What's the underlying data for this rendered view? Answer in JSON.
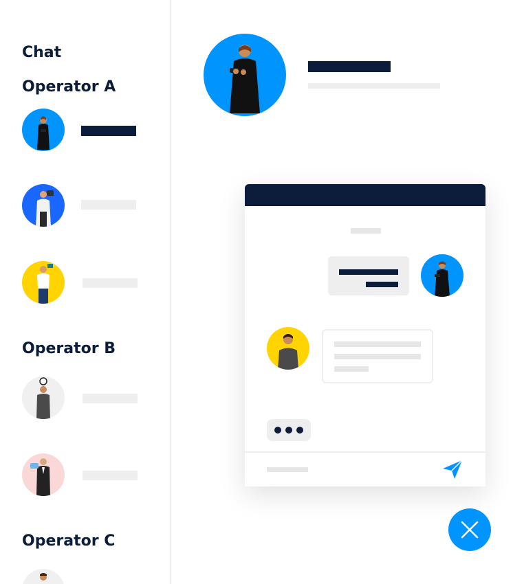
{
  "sidebar": {
    "title": "Chat",
    "groups": [
      {
        "label": "Operator A"
      },
      {
        "label": "Operator B"
      },
      {
        "label": "Operator C"
      }
    ]
  },
  "colors": {
    "navy": "#0b1d3a",
    "blue": "#0094ff",
    "royal_blue": "#1967ff",
    "yellow": "#ffd400",
    "light_gray": "#eeeeee",
    "pale_gray": "#f0f0f0",
    "salmon": "#fbd8d8"
  },
  "icons": {
    "send": "paper-plane-icon",
    "close": "close-icon"
  }
}
